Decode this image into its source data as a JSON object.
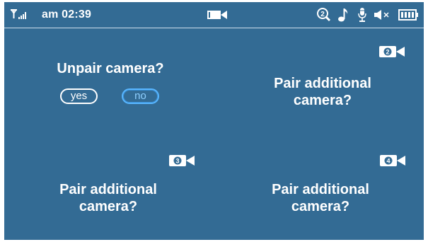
{
  "status_bar": {
    "time": "am 02:39",
    "icons": [
      "signal-icon",
      "video-camera-icon",
      "zoom-2-icon",
      "music-note-icon",
      "microphone-icon",
      "speaker-muted-icon",
      "battery-icon"
    ],
    "zoom_digit": "2"
  },
  "quadrants": {
    "q1": {
      "title": "Unpair camera?",
      "yes_label": "yes",
      "no_label": "no"
    },
    "q2": {
      "badge_number": "2",
      "title_line1": "Pair additional",
      "title_line2": "camera?"
    },
    "q3": {
      "badge_number": "3",
      "title_line1": "Pair additional",
      "title_line2": "camera?"
    },
    "q4": {
      "badge_number": "4",
      "title_line1": "Pair additional",
      "title_line2": "camera?"
    }
  },
  "colors": {
    "background": "#336b94",
    "text": "#ffffff",
    "no_button_accent": "#58b6ff"
  }
}
